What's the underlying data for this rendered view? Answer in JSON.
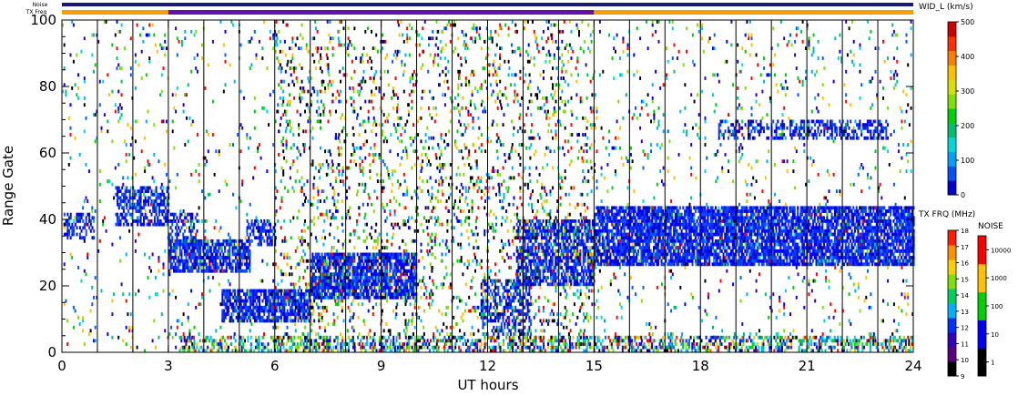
{
  "chart_data": {
    "type": "heatmap",
    "xlabel": "UT hours",
    "ylabel": "Range Gate",
    "xlim": [
      0,
      24
    ],
    "ylim": [
      0,
      100
    ],
    "x_ticks": [
      0,
      3,
      6,
      9,
      12,
      15,
      18,
      21,
      24
    ],
    "y_ticks": [
      0,
      20,
      40,
      60,
      80,
      100
    ],
    "scan_boundaries_hours": [
      1,
      2,
      3,
      4,
      5,
      6,
      7,
      8,
      9,
      10,
      11,
      12,
      13,
      14,
      15,
      16,
      17,
      18,
      19,
      20,
      21,
      22,
      23
    ],
    "top_bars": {
      "noise_label": "Noise",
      "txfreq_label": "TX Freq",
      "txfreq_segments": [
        {
          "start": 0,
          "end": 3,
          "color": "#f5a000"
        },
        {
          "start": 3,
          "end": 15,
          "color": "#6a0dad"
        },
        {
          "start": 15,
          "end": 24,
          "color": "#f5a000"
        }
      ]
    },
    "spectral_width_colorbar": {
      "title": "WID_L (km/s)",
      "ticks": [
        0,
        100,
        200,
        300,
        400,
        500
      ],
      "range": [
        0,
        500
      ],
      "colors": [
        "#0000d0",
        "#0050ff",
        "#00a0ff",
        "#00d8d8",
        "#00c070",
        "#00d000",
        "#80e000",
        "#d8e000",
        "#ffc000",
        "#ff8000",
        "#ff3000",
        "#d00000"
      ]
    },
    "txfreq_colorbar": {
      "title": "TX FRQ (MHz)",
      "ticks": [
        9,
        10,
        11,
        12,
        13,
        14,
        15,
        16,
        17,
        18
      ],
      "colors": [
        "#000000",
        "#5a0080",
        "#3000c0",
        "#0030ff",
        "#00b0ff",
        "#00d060",
        "#80e000",
        "#ffd000",
        "#ff9000",
        "#ff2000"
      ]
    },
    "noise_colorbar": {
      "title": "NOISE",
      "ticks": [
        "1",
        "10",
        "100",
        "1000",
        "10000"
      ],
      "colors": [
        "#000000",
        "#0000ff",
        "#00d000",
        "#ffc000",
        "#ff0000"
      ]
    },
    "echo_regions": [
      {
        "x0": 0.05,
        "x1": 0.9,
        "y0": 34,
        "y1": 42,
        "density": 0.5,
        "palette": "blue"
      },
      {
        "x0": 1.5,
        "x1": 3.0,
        "y0": 38,
        "y1": 50,
        "density": 0.6,
        "palette": "blue"
      },
      {
        "x0": 3.0,
        "x1": 5.3,
        "y0": 24,
        "y1": 34,
        "density": 0.75,
        "palette": "blue"
      },
      {
        "x0": 3.0,
        "x1": 3.8,
        "y0": 32,
        "y1": 42,
        "density": 0.5,
        "palette": "blue"
      },
      {
        "x0": 5.2,
        "x1": 6.0,
        "y0": 32,
        "y1": 40,
        "density": 0.5,
        "palette": "blue"
      },
      {
        "x0": 4.5,
        "x1": 7.0,
        "y0": 9,
        "y1": 19,
        "density": 0.75,
        "palette": "blue"
      },
      {
        "x0": 7.0,
        "x1": 10.0,
        "y0": 16,
        "y1": 30,
        "density": 0.8,
        "palette": "blue"
      },
      {
        "x0": 11.8,
        "x1": 13.2,
        "y0": 5,
        "y1": 22,
        "density": 0.5,
        "palette": "blue"
      },
      {
        "x0": 12.8,
        "x1": 15.0,
        "y0": 20,
        "y1": 40,
        "density": 0.65,
        "palette": "blue"
      },
      {
        "x0": 15.0,
        "x1": 24.0,
        "y0": 26,
        "y1": 44,
        "density": 0.8,
        "palette": "blue"
      },
      {
        "x0": 18.5,
        "x1": 23.3,
        "y0": 64,
        "y1": 70,
        "density": 0.45,
        "palette": "blue"
      },
      {
        "x0": 3.3,
        "x1": 24.0,
        "y0": 0,
        "y1": 5,
        "density": 0.45,
        "palette": "mixed"
      },
      {
        "x0": 0.0,
        "x1": 24.0,
        "y0": 0,
        "y1": 100,
        "density": 0.04,
        "palette": "mixed"
      },
      {
        "x0": 6.0,
        "x1": 15.0,
        "y0": 0,
        "y1": 100,
        "density": 0.09,
        "palette": "noisy"
      }
    ]
  }
}
